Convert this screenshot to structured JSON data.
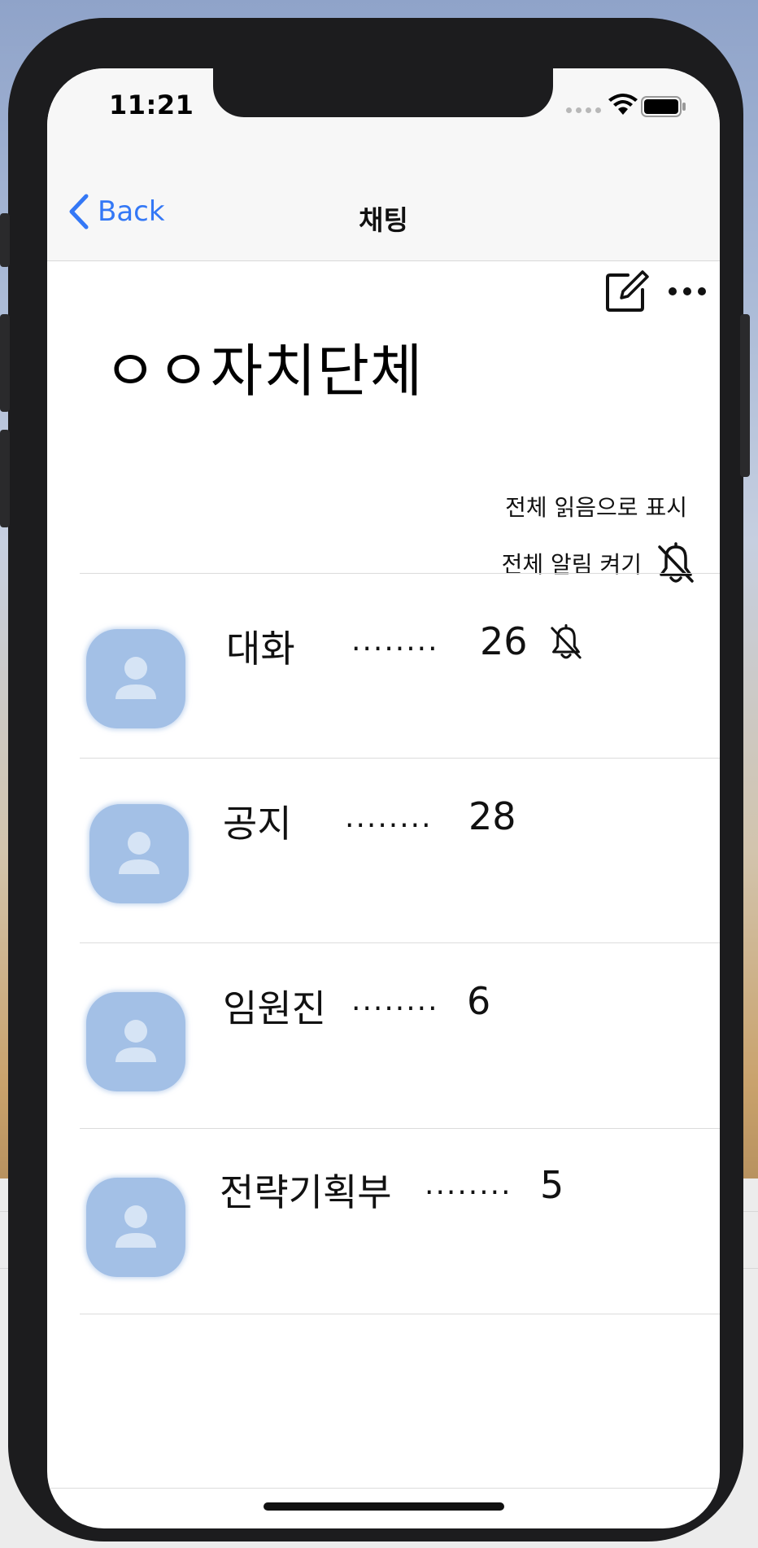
{
  "status_bar": {
    "time": "11:21"
  },
  "nav": {
    "back_label": "Back",
    "title": "채팅"
  },
  "header": {
    "org_title": "ㅇㅇ자치단체",
    "mark_all_read": "전체 읽음으로 표시",
    "all_notifications_on": "전체 알림 켜기"
  },
  "chats": [
    {
      "name": "대화",
      "dots": "........",
      "count": "26",
      "muted": true
    },
    {
      "name": "공지",
      "dots": "........",
      "count": "28",
      "muted": false
    },
    {
      "name": "임원진",
      "dots": "........",
      "count": "6",
      "muted": false
    },
    {
      "name": "전략기획부",
      "dots": "........",
      "count": "5",
      "muted": false
    }
  ],
  "colors": {
    "accent": "#3478f6",
    "avatar": "#a3c0e6",
    "frame": "#1c1c1e"
  }
}
